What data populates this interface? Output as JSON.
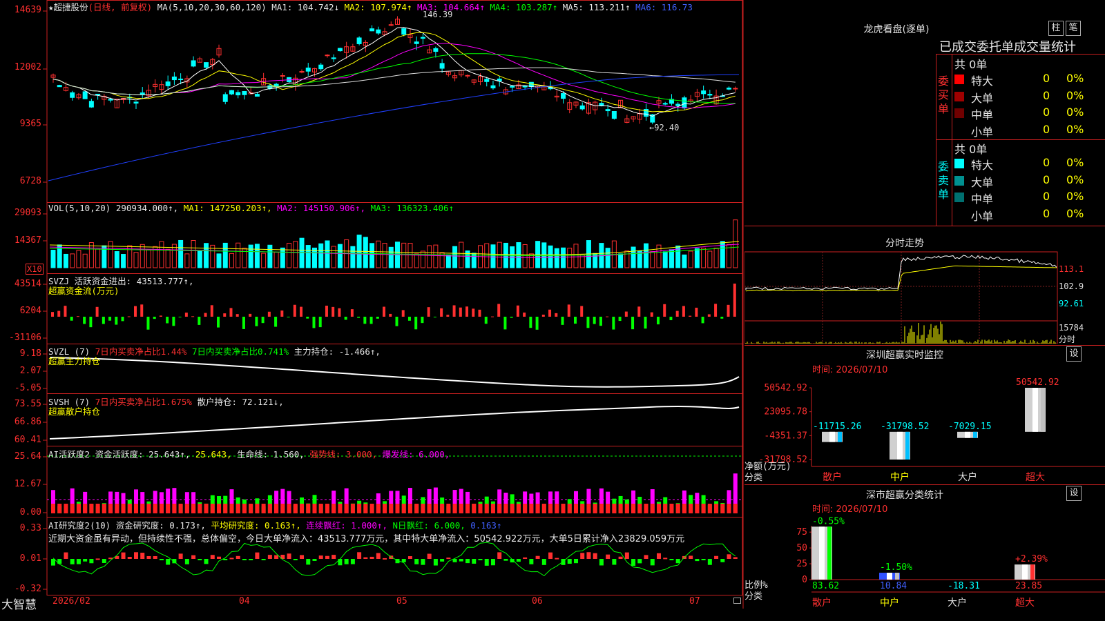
{
  "main": {
    "star": "★",
    "stock_name": "超捷股份",
    "period": "(日线, 前复权)",
    "ma_label": "MA(5,10,20,30,60,120)",
    "ma1": "MA1: 104.742↓",
    "ma2": "MA2: 107.974↑",
    "ma3": "MA3: 104.664↑",
    "ma4": "MA4: 103.287↑",
    "ma5": "MA5: 113.211↑",
    "ma6": "MA6: 116.73",
    "high_mark": "146.39",
    "low_mark": "←92.40",
    "y_ticks": [
      "14639",
      "12002",
      "9365",
      "6728"
    ]
  },
  "vol": {
    "label": "VOL(5,10,20)",
    "value": "290934.000↑,",
    "ma1": "MA1: 147250.203↑,",
    "ma2": "MA2: 145150.906↑,",
    "ma3": "MA3: 136323.406↑",
    "y_ticks": [
      "29093",
      "14367"
    ],
    "unit": "X10"
  },
  "svzj": {
    "label": "SVZJ",
    "text": "活跃资金进出: 43513.777↑,",
    "sub": "超赢资金流(万元)",
    "y_ticks": [
      "43514",
      "6204",
      "-31106"
    ]
  },
  "svzl": {
    "label": "SVZL (7)",
    "red_text": "7日内买卖净占比1.44%",
    "grn_text": "7日内买卖净占比0.741%",
    "wht_text": "主力持仓: -1.466↑,",
    "sub": "超赢主力持仓",
    "y_ticks": [
      "9.18",
      "2.07",
      "-5.05"
    ]
  },
  "svsh": {
    "label": "SVSH (7)",
    "red_text": "7日内买卖净占比1.675%",
    "wht_text": "散户持仓: 72.121↓,",
    "sub": "超赢散户持仓",
    "y_ticks": [
      "73.55",
      "66.86",
      "60.41"
    ]
  },
  "ai2": {
    "label": "AI活跃度2",
    "t1": "资金活跃度: 25.643↑,",
    "t2": "25.643,",
    "t3": "生命线: 1.560,",
    "t4": "强势线: 3.000,",
    "t5": "爆发线: 6.000,",
    "y_ticks": [
      "25.64",
      "12.67",
      "0.00"
    ]
  },
  "ai3": {
    "label": "AI研究度2(10)",
    "t1": "资金研究度: 0.173↑,",
    "t2": "平均研究度: 0.163↑,",
    "t3": "连续飘红: 1.000↑,",
    "t4": "N日飘红: 6.000,",
    "t5": "0.163↑",
    "comment": "近期大资金虽有异动，但持续性不强，总体偏空，今日大单净流入：43513.777万元，其中特大单净流入：50542.922万元，大单5日累计净入23829.059万元",
    "y_ticks": [
      "0.33",
      "0.01",
      "-0.32"
    ]
  },
  "bottom": {
    "brand": "大智慧",
    "dates": [
      "2026/02",
      "04",
      "05",
      "06",
      "07"
    ]
  },
  "lhb": {
    "title": "龙虎看盘(逐单)",
    "btn1": "柱",
    "btn2": "笔",
    "subtitle": "已成交委托单成交量统计",
    "buy_side": "委买单",
    "sell_side": "委卖单",
    "buy_total": "共 0单",
    "sell_total": "共 0单",
    "rows_buy": [
      {
        "name": "特大",
        "count": "0",
        "pct": "0%",
        "color": "#ff0000"
      },
      {
        "name": "大单",
        "count": "0",
        "pct": "0%",
        "color": "#a00000"
      },
      {
        "name": "中单",
        "count": "0",
        "pct": "0%",
        "color": "#700000"
      },
      {
        "name": "小单",
        "count": "0",
        "pct": "0%",
        "color": ""
      }
    ],
    "rows_sell": [
      {
        "name": "特大",
        "count": "0",
        "pct": "0%",
        "color": "#00ffff"
      },
      {
        "name": "大单",
        "count": "0",
        "pct": "0%",
        "color": "#009090"
      },
      {
        "name": "中单",
        "count": "0",
        "pct": "0%",
        "color": "#007070"
      },
      {
        "name": "小单",
        "count": "0",
        "pct": "0%",
        "color": ""
      }
    ]
  },
  "intraday": {
    "title": "分时走势",
    "p1": "113.1",
    "p2": "102.9",
    "p3": "92.61",
    "v1": "15784",
    "v2": "分时"
  },
  "sz_monitor": {
    "title": "深圳超赢实时监控",
    "settings": "设",
    "time": "时间: 2026/07/10",
    "y_ticks": [
      "50542.92",
      "23095.78",
      "-4351.37",
      "-31798.52"
    ],
    "unit1": "净额(万元)",
    "unit2": "分类",
    "bars": [
      {
        "cat": "散户",
        "value": -11715.26,
        "label": "-11715.26"
      },
      {
        "cat": "中户",
        "value": -31798.52,
        "label": "-31798.52"
      },
      {
        "cat": "大户",
        "value": -7029.15,
        "label": "-7029.15"
      },
      {
        "cat": "超大",
        "value": 50542.92,
        "label": "50542.92"
      }
    ]
  },
  "sz_class": {
    "title": "深市超赢分类统计",
    "settings": "设",
    "time": "时间: 2026/07/10",
    "y_ticks": [
      "75",
      "50",
      "25",
      "0"
    ],
    "unit1": "比例%",
    "unit2": "分类",
    "bars": [
      {
        "cat": "散户",
        "value": 83.62,
        "top": "-0.55%",
        "bottom": "83.62"
      },
      {
        "cat": "中户",
        "value": 10.84,
        "top": "-1.50%",
        "bottom": "10.84"
      },
      {
        "cat": "大户",
        "value": -18.31,
        "top": "",
        "bottom": "-18.31"
      },
      {
        "cat": "超大",
        "value": 23.85,
        "top": "+2.39%",
        "bottom": "23.85"
      }
    ]
  }
}
